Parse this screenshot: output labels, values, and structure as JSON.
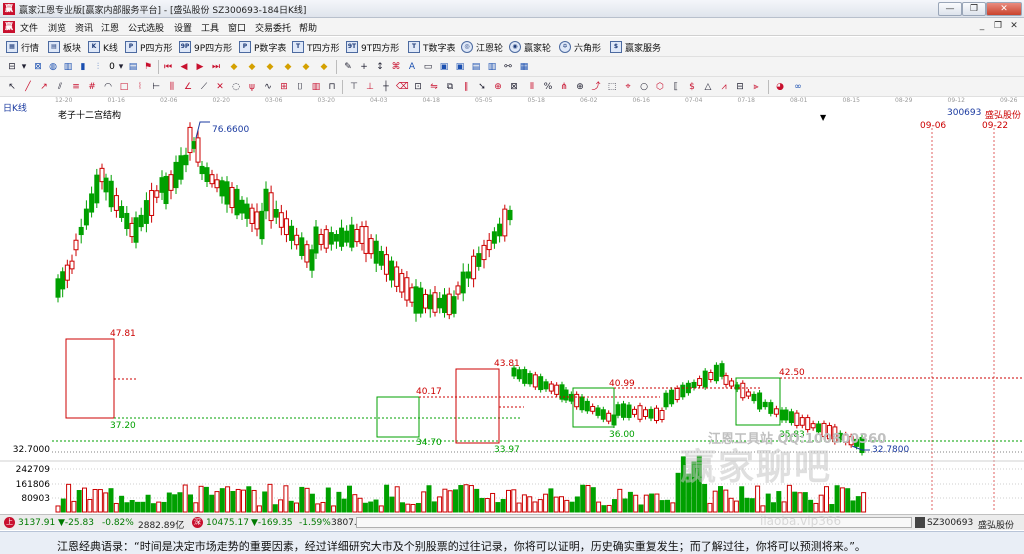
{
  "window": {
    "title": "赢家江恩专业版[赢家内部服务平台] - [盛弘股份  SZ300693-184日K线]",
    "logo": "赢",
    "buttons": {
      "minimize": "—",
      "restore": "❐",
      "close": "✕"
    }
  },
  "menu": {
    "logo": "赢",
    "items": [
      "文件",
      "浏览",
      "资讯",
      "江恩",
      "公式选股",
      "设置",
      "工具",
      "窗口",
      "交易委托",
      "帮助"
    ],
    "mdi": [
      "_",
      "❐",
      "✕"
    ]
  },
  "toolbar1": {
    "items": [
      {
        "label": "行情",
        "icon": "grid-icon"
      },
      {
        "label": "板块",
        "icon": "blocks-icon"
      },
      {
        "label": "K线",
        "icon": "candle-icon"
      },
      {
        "label": "P四方形",
        "icon": "p-square-icon"
      },
      {
        "label": "9P四方形",
        "icon": "9p-square-icon"
      },
      {
        "label": "P数字表",
        "icon": "p-table-icon"
      },
      {
        "label": "T四方形",
        "icon": "t-square-icon"
      },
      {
        "label": "9T四方形",
        "icon": "9t-square-icon"
      },
      {
        "label": "T数字表",
        "icon": "t-table-icon"
      },
      {
        "label": "江恩轮",
        "icon": "gann-wheel-icon"
      },
      {
        "label": "赢家轮",
        "icon": "winner-wheel-icon"
      },
      {
        "label": "六角形",
        "icon": "hexagon-icon"
      },
      {
        "label": "赢家服务",
        "icon": "service-icon"
      }
    ]
  },
  "toolbar2": {
    "small_label": "0"
  },
  "period": "日K线",
  "chart_name": "老子十二宫结构",
  "stock_code": "300693",
  "stock_name": "盛弘股份",
  "future_dates": [
    "09-06",
    "09-22"
  ],
  "watermark": {
    "contact": "江恩工具站 QQ:100800360",
    "brand": "赢家聊吧",
    "site": "liaoba.vip366"
  },
  "chart_data": {
    "type": "candlestick",
    "date_ticks": [
      "12-20",
      "01-16",
      "02-06",
      "02-20",
      "03-06",
      "03-20",
      "04-03",
      "04-18",
      "05-05",
      "05-18",
      "06-02",
      "06-16",
      "07-04",
      "07-18",
      "08-01",
      "08-15",
      "08-29",
      "09-12",
      "09-26"
    ],
    "high_label": "76.6600",
    "low_label": "32.7800",
    "axis_labels": [
      "32.7000",
      "242709",
      "161806",
      "80903"
    ],
    "gann_box_labels": [
      "47.81",
      "37.20",
      "40.17",
      "34.70",
      "43.81",
      "33.97",
      "40.99",
      "36.00",
      "42.50",
      "35.83"
    ],
    "colors": {
      "up": "#cc0000",
      "down": "#00a000",
      "box": "#cc0000",
      "box2": "#00a000"
    }
  },
  "status": {
    "sh_icon": "上",
    "sh_index": "3137.91",
    "sh_change": "▼-25.83",
    "sh_pct": "-0.82%",
    "sh_amount": "2882.89亿",
    "sz_icon": "深",
    "sz_index": "10475.17",
    "sz_change": "▼-169.35",
    "sz_pct": "-1.59%",
    "sz_amount": "3807.",
    "right_code": "SZ300693",
    "right_name": "盛弘股份"
  },
  "quote": "江恩经典语录：“时间是决定市场走势的重要因素，经过详细研究大市及个别股票的过往记录，你将可以证明，历史确实重复发生；而了解过往，你将可以预测将来。”。"
}
